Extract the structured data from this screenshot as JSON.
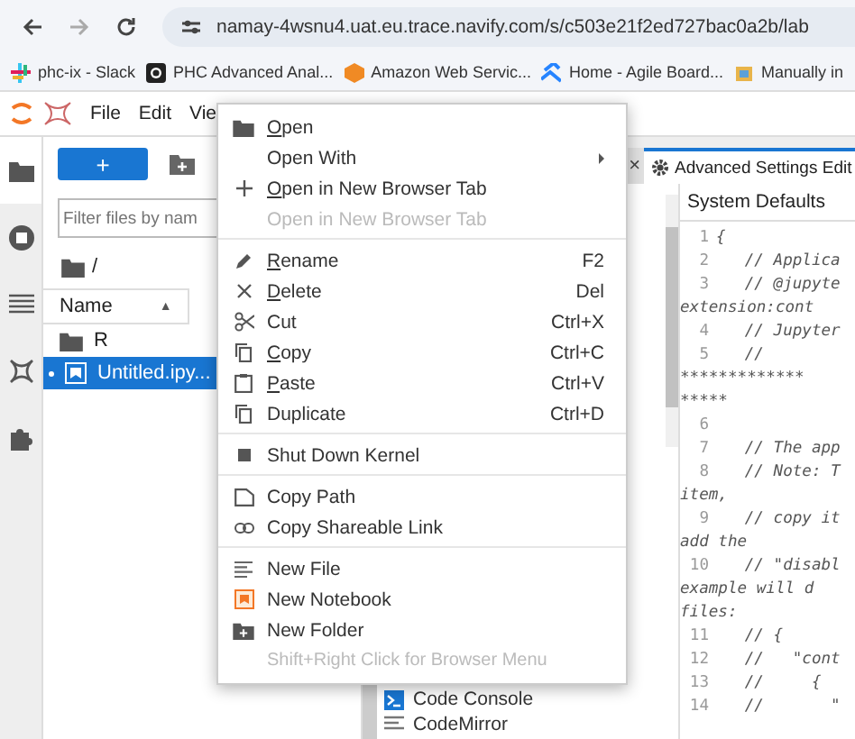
{
  "browser": {
    "url": "namay-4wsnu4.uat.eu.trace.navify.com/s/c503e21f2ed727bac0a2b/lab",
    "bookmarks": [
      {
        "label": "phc-ix - Slack",
        "kind": "slack"
      },
      {
        "label": "PHC Advanced Anal...",
        "kind": "github"
      },
      {
        "label": "Amazon Web Servic...",
        "kind": "cube"
      },
      {
        "label": "Home - Agile Board...",
        "kind": "jira"
      },
      {
        "label": "Manually in",
        "kind": "box"
      }
    ]
  },
  "menubar": [
    "File",
    "Edit",
    "Vie"
  ],
  "sidebar": [
    {
      "kind": "folder",
      "selected": true
    },
    {
      "kind": "stop",
      "selected": false
    },
    {
      "kind": "list",
      "selected": false
    },
    {
      "kind": "jupyter",
      "selected": false
    },
    {
      "kind": "puzzle",
      "selected": false
    }
  ],
  "filebrowser": {
    "new_button": "+",
    "filter": {
      "placeholder": "Filter files by nam"
    },
    "breadcrumb": "/",
    "column": "Name",
    "sort_caret": "▲",
    "rows": [
      {
        "name": "R",
        "kind": "folder",
        "selected": false
      },
      {
        "name": "Untitled.ipy...",
        "kind": "notebook",
        "selected": true
      }
    ]
  },
  "context_menu": [
    {
      "kind": "item",
      "label": "Open",
      "mnemonic": true,
      "disabled": false
    },
    {
      "kind": "item",
      "label": "Open With",
      "submenu": true,
      "disabled": false
    },
    {
      "kind": "item",
      "label": "Open in New Browser Tab",
      "mnemonic": true,
      "disabled": false
    },
    {
      "kind": "item",
      "label": "Open in New Browser Tab",
      "disabled": true
    },
    {
      "kind": "separator"
    },
    {
      "kind": "item",
      "label": "Rename",
      "shortcut": "F2",
      "mnemonic": true,
      "disabled": false
    },
    {
      "kind": "item",
      "label": "Delete",
      "shortcut": "Del",
      "mnemonic": true,
      "disabled": false
    },
    {
      "kind": "item",
      "label": "Cut",
      "shortcut": "Ctrl+X",
      "disabled": false
    },
    {
      "kind": "item",
      "label": "Copy",
      "shortcut": "Ctrl+C",
      "mnemonic": true,
      "disabled": false
    },
    {
      "kind": "item",
      "label": "Paste",
      "shortcut": "Ctrl+V",
      "mnemonic": true,
      "disabled": false
    },
    {
      "kind": "item",
      "label": "Duplicate",
      "shortcut": "Ctrl+D",
      "disabled": false
    },
    {
      "kind": "separator"
    },
    {
      "kind": "item",
      "label": "Shut Down Kernel",
      "disabled": false
    },
    {
      "kind": "separator"
    },
    {
      "kind": "item",
      "label": "Copy Path",
      "disabled": false
    },
    {
      "kind": "item",
      "label": "Copy Shareable Link",
      "disabled": false
    },
    {
      "kind": "separator"
    },
    {
      "kind": "item",
      "label": "New File",
      "disabled": false
    },
    {
      "kind": "item",
      "label": "New Notebook",
      "disabled": false
    },
    {
      "kind": "item",
      "label": "New Folder",
      "disabled": false
    },
    {
      "kind": "hint",
      "label": "Shift+Right Click for Browser Menu"
    }
  ],
  "settings": {
    "tab_close": "×",
    "tab": "Advanced Settings Edit",
    "header": "System Defaults",
    "code": [
      {
        "number": "1",
        "text": "{"
      },
      {
        "number": "2",
        "text": "   // Applica"
      },
      {
        "number": "3",
        "text": "   // @jupyte"
      },
      {
        "text": "extension:cont"
      },
      {
        "number": "4",
        "text": "   // Jupyter"
      },
      {
        "number": "5",
        "text": "   //"
      },
      {
        "text": "*************"
      },
      {
        "text": "*****"
      },
      {
        "number": "6"
      },
      {
        "number": "7",
        "text": "   // The app"
      },
      {
        "number": "8",
        "text": "   // Note: T"
      },
      {
        "text": "item,"
      },
      {
        "number": "9",
        "text": "   // copy it"
      },
      {
        "text": "add the"
      },
      {
        "number": "10",
        "text": "   // \"disabl"
      },
      {
        "text": "example will d"
      },
      {
        "text": "files:"
      },
      {
        "number": "11",
        "text": "   // {"
      },
      {
        "number": "12",
        "text": "   //   \"cont"
      },
      {
        "number": "13",
        "text": "   //     {"
      },
      {
        "number": "14",
        "text": "   //       \""
      }
    ]
  },
  "launcher": [
    {
      "label": "Code Console",
      "kind": "console"
    },
    {
      "label": "CodeMirror",
      "kind": "text"
    }
  ]
}
